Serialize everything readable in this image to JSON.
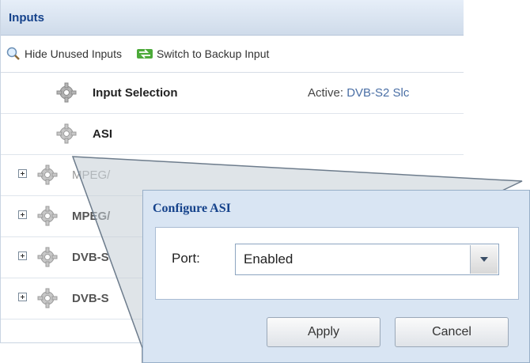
{
  "panel": {
    "title": "Inputs",
    "toolbar": {
      "hide_unused": "Hide Unused Inputs",
      "switch_backup": "Switch to Backup Input"
    },
    "rows": [
      {
        "label": "Input Selection",
        "status_prefix": "Active: ",
        "status_value": "DVB-S2 Slc"
      },
      {
        "label": "ASI"
      },
      {
        "label": "MPEG/"
      },
      {
        "label": "MPEG/"
      },
      {
        "label": "DVB-S"
      },
      {
        "label": "DVB-S"
      }
    ]
  },
  "dialog": {
    "title": "Configure ASI",
    "port_label": "Port:",
    "port_value": "Enabled",
    "apply": "Apply",
    "cancel": "Cancel"
  },
  "colors": {
    "header_text": "#15428b",
    "dialog_bg": "#d9e5f3",
    "status_value": "#4a6fa5"
  }
}
